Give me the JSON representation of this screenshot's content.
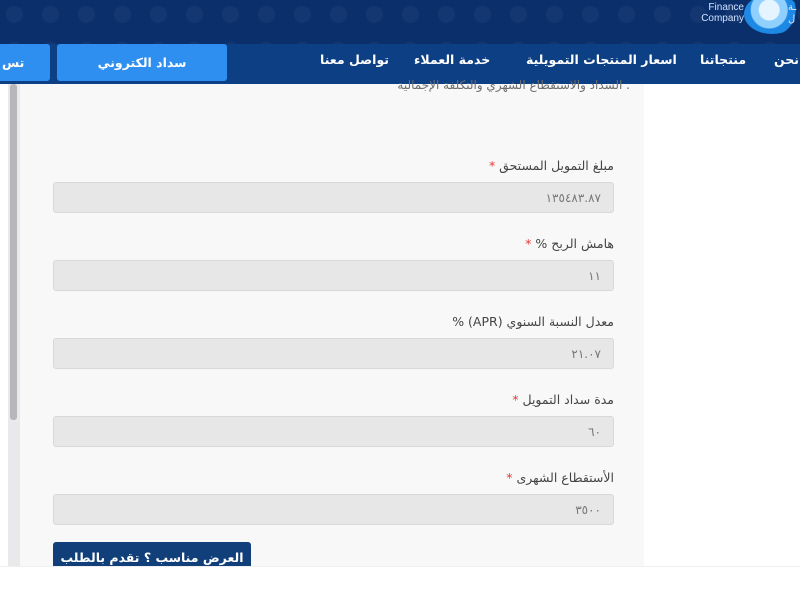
{
  "header": {
    "logo_en": "Finance Company",
    "logo_ar": "ـة ل"
  },
  "nav": {
    "pay_button": "سداد الكتروني",
    "cut_button": "تس",
    "items": [
      "نحن",
      "منتجاتنا",
      "اسعار المنتجات التمويلية",
      "خدمة العملاء",
      "تواصل معنا"
    ]
  },
  "content": {
    "intro": "السداد والاستقطاع الشهري والتكلفة الإجمالية .",
    "fields": [
      {
        "label": "مبلغ التمويل المستحق",
        "required": "*",
        "value": "١٣٥٤٨٣.٨٧"
      },
      {
        "label": "هامش الربح %",
        "required": "*",
        "value": "١١"
      },
      {
        "label": "معدل النسبة السنوي (APR) %",
        "required": "",
        "value": "٢١.٠٧"
      },
      {
        "label": "مدة سداد التمويل",
        "required": "*",
        "value": "٦٠"
      },
      {
        "label": "الأستقطاع الشهرى",
        "required": "*",
        "value": "٣٥٠٠"
      }
    ],
    "submit": "العرض مناسب ؟ تقدم بالطلب"
  }
}
